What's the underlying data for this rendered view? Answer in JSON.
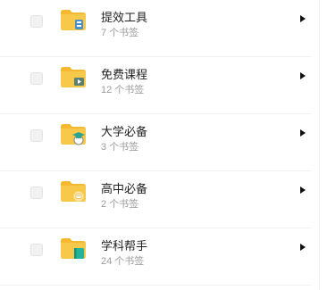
{
  "folders": [
    {
      "title": "提效工具",
      "count": "7 个书签",
      "badge": "tools",
      "badge_color": "#4a90c8"
    },
    {
      "title": "免费课程",
      "count": "12 个书签",
      "badge": "video",
      "badge_color": "#5a7f73"
    },
    {
      "title": "大学必备",
      "count": "3 个书签",
      "badge": "graduation-cap",
      "badge_color": "#2aa38f"
    },
    {
      "title": "高中必备",
      "count": "2 个书签",
      "badge": "book",
      "badge_color": "#e6b54a"
    },
    {
      "title": "学科帮手",
      "count": "24 个书签",
      "badge": "notebook",
      "badge_color": "#24b39b"
    }
  ],
  "colors": {
    "folder_body": "#f7c94a",
    "folder_back": "#f3b930"
  }
}
